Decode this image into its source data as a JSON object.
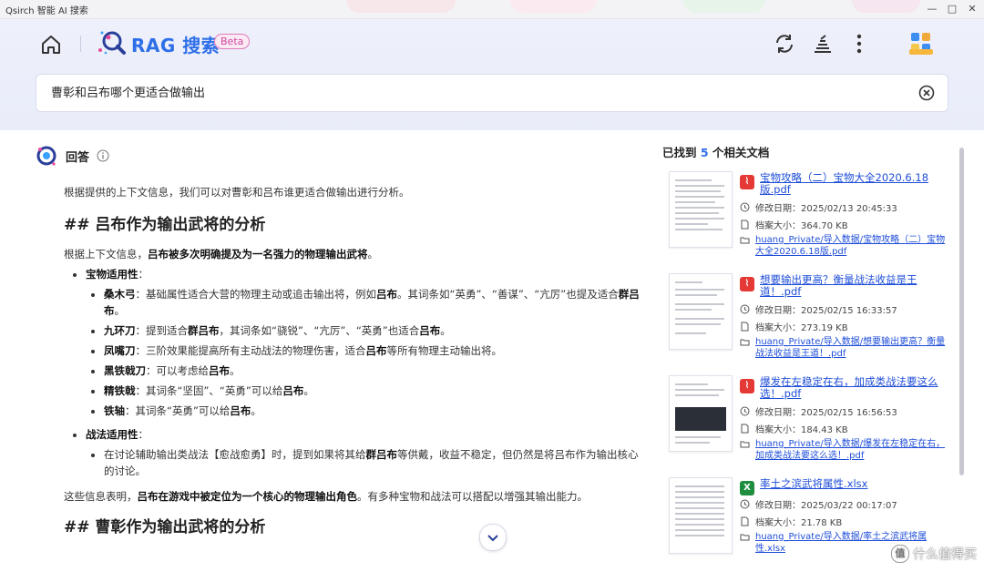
{
  "window": {
    "title": "Qsirch 智能 AI 搜索",
    "controls": [
      "—",
      "□",
      "✕"
    ]
  },
  "header": {
    "app_title": "RAG 搜索",
    "beta_label": "Beta"
  },
  "search": {
    "value": "曹彰和吕布哪个更适合做输出",
    "placeholder": ""
  },
  "answer": {
    "label": "回答",
    "intro": "根据提供的上下文信息，我们可以对曹彰和吕布谁更适合做输出进行分析。",
    "h1": "## 吕布作为输出武将的分析",
    "p1_pre": "根据上下文信息，",
    "p1_bold": "吕布被多次明确提及为一名强力的物理输出武将",
    "p1_post": "。",
    "treasure_title": "宝物适用性",
    "treasures": [
      {
        "name": "桑木弓",
        "pre": "基础属性适合大营的物理主动或追击输出将，例如",
        "b1": "吕布",
        "mid": "。其词条如“英勇”、“善谋”、“亢厉”也提及适合",
        "b2": "群吕布",
        "post": "。"
      },
      {
        "name": "九环刀",
        "pre": "提到适合",
        "b1": "群吕布",
        "mid": "，其词条如“骁锐”、“亢厉”、“英勇”也适合",
        "b2": "吕布",
        "post": "。"
      },
      {
        "name": "凤嘴刀",
        "pre": "三阶效果能提高所有主动战法的物理伤害，适合",
        "b1": "吕布",
        "mid": "等所有物理主动输出将。",
        "b2": "",
        "post": ""
      },
      {
        "name": "黑铁戟刀",
        "pre": "可以考虑给",
        "b1": "吕布",
        "mid": "。",
        "b2": "",
        "post": ""
      },
      {
        "name": "精铁戟",
        "pre": "其词条“坚固”、“英勇”可以给",
        "b1": "吕布",
        "mid": "。",
        "b2": "",
        "post": ""
      },
      {
        "name": "铁轴",
        "pre": "其词条“英勇”可以给",
        "b1": "吕布",
        "mid": "。",
        "b2": "",
        "post": ""
      }
    ],
    "tactic_title": "战法适用性",
    "tactic_pre": "在讨论辅助输出类战法【愈战愈勇】时，提到如果将其给",
    "tactic_bold": "群吕布",
    "tactic_post": "等供戴，收益不稳定，但仍然是将吕布作为输出核心的讨论。",
    "summary_pre": "这些信息表明，",
    "summary_bold": "吕布在游戏中被定位为一个核心的物理输出角色",
    "summary_post": "。有多种宝物和战法可以搭配以增强其输出能力。",
    "h2": "## 曹彰作为输出武将的分析"
  },
  "docs": {
    "title_pre": "已找到 ",
    "count": "5",
    "title_post": " 个相关文档",
    "items": [
      {
        "type": "pdf",
        "icon_color": "#e53935",
        "name": "宝物攻略（二）宝物大全2020.6.18版.pdf",
        "date": "修改日期：2025/02/13 20:45:33",
        "size": "档案大小：364.70 KB",
        "path": "huang_Private/导入数据/宝物攻略（二）宝物大全2020.6.18版.pdf"
      },
      {
        "type": "pdf",
        "icon_color": "#e53935",
        "name": "想要输出更高？衡量战法收益是王道！.pdf",
        "date": "修改日期：2025/02/15 16:33:57",
        "size": "档案大小：273.19 KB",
        "path": "huang_Private/导入数据/想要输出更高？衡量战法收益是王道！.pdf"
      },
      {
        "type": "pdf",
        "icon_color": "#e53935",
        "name": "爆发在左稳定在右，加成类战法要这么选！.pdf",
        "date": "修改日期：2025/02/15 16:56:53",
        "size": "档案大小：184.43 KB",
        "path": "huang_Private/导入数据/爆发在左稳定在右，加成类战法要这么选！.pdf"
      },
      {
        "type": "xlsx",
        "icon_color": "#1e8e3e",
        "name": "率土之滨武将属性.xlsx",
        "date": "修改日期：2025/03/22 00:17:07",
        "size": "档案大小：21.78 KB",
        "path": "huang_Private/导入数据/率土之滨武将属性.xlsx"
      }
    ]
  },
  "watermark": "什么值得买"
}
